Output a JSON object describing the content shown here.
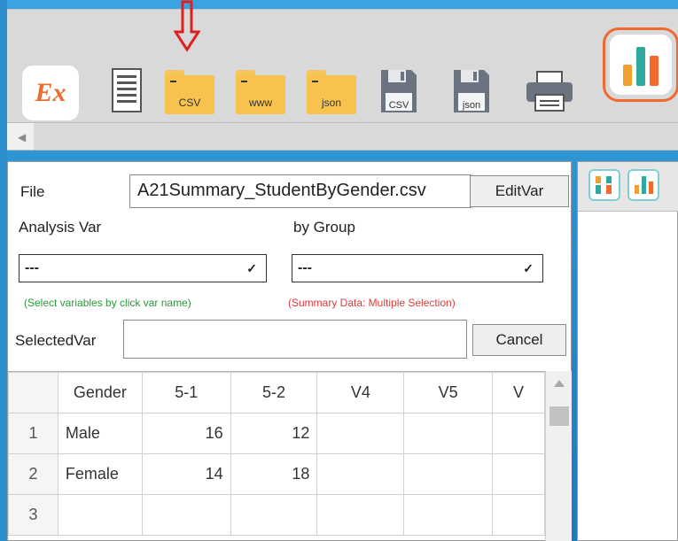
{
  "toolbar": {
    "logo_text": "Ex",
    "folders": [
      "CSV",
      "www",
      "json"
    ],
    "save_buttons": [
      "CSV",
      "json"
    ],
    "icons": [
      "ex-logo-icon",
      "document-icon",
      "folder-csv-icon",
      "folder-www-icon",
      "folder-json-icon",
      "save-csv-icon",
      "save-json-icon",
      "printer-icon",
      "bar-chart-icon"
    ]
  },
  "form": {
    "file_label": "File",
    "file_value": "A21Summary_StudentByGender.csv",
    "editvar_label": "EditVar",
    "analysis_label": "Analysis Var",
    "group_label": "by Group",
    "analysis_value": "---",
    "group_value": "---",
    "hint_select": "(Select variables by click var name)",
    "hint_summary": "(Summary Data: Multiple Selection)",
    "selectedvar_label": "SelectedVar",
    "selectedvar_value": "",
    "cancel_label": "Cancel"
  },
  "grid": {
    "columns": [
      "Gender",
      "5-1",
      "5-2",
      "V4",
      "V5",
      "V"
    ],
    "rows": [
      {
        "num": "1",
        "cells": [
          "Male",
          "16",
          "12",
          "",
          "",
          ""
        ]
      },
      {
        "num": "2",
        "cells": [
          "Female",
          "14",
          "18",
          "",
          "",
          ""
        ]
      },
      {
        "num": "3",
        "cells": [
          "",
          "",
          "",
          "",
          "",
          ""
        ]
      }
    ]
  },
  "colors": {
    "accent_orange": "#f06a2e",
    "hint_green": "#2a9a3a",
    "hint_red": "#e03a3a",
    "folder_yellow": "#f7c24e",
    "background_blue": "#2a8fd0"
  }
}
